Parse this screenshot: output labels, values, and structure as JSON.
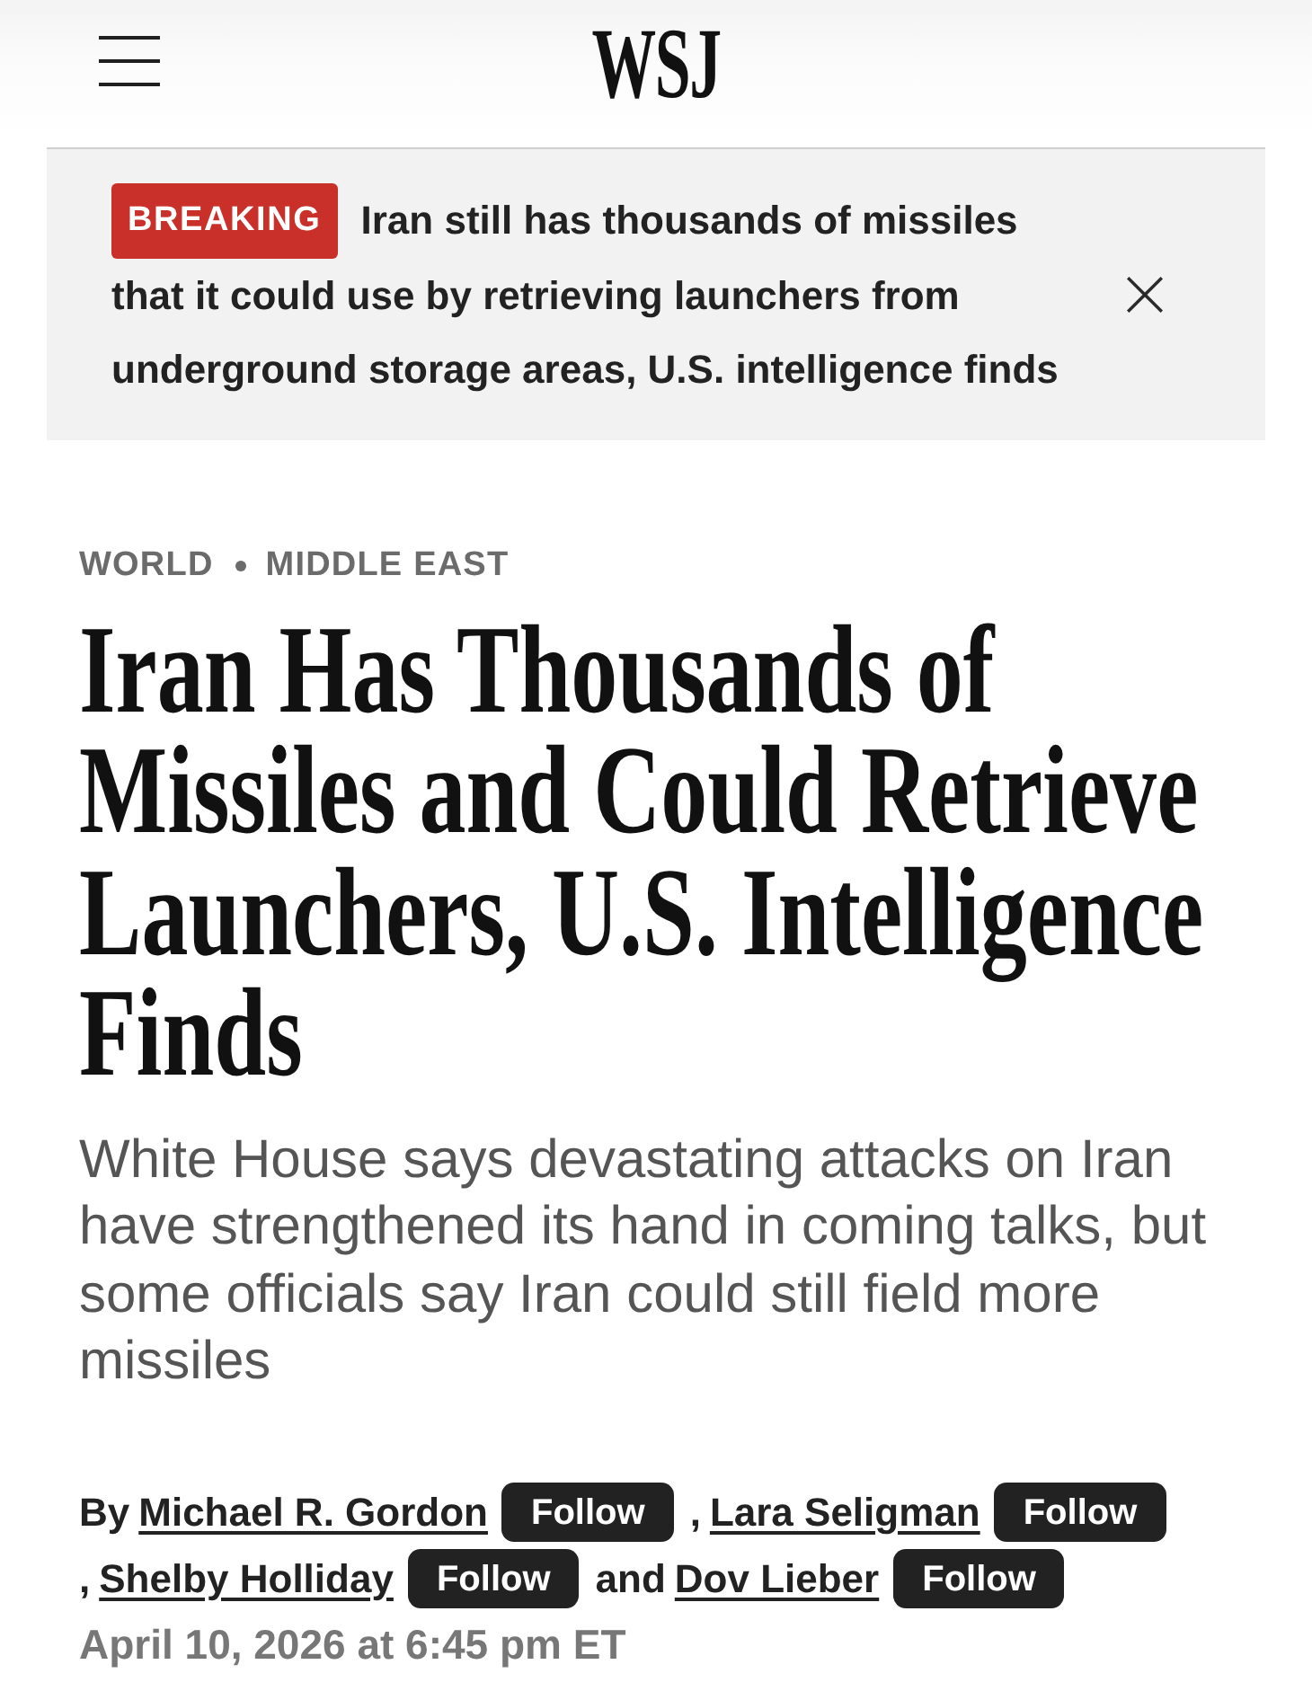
{
  "header": {
    "logo": "WSJ"
  },
  "breaking": {
    "badge": "BREAKING",
    "headline": "Iran still has thousands of missiles that it could use by retrieving launchers from underground storage areas, U.S. intelligence finds"
  },
  "article": {
    "sections": [
      "WORLD",
      "MIDDLE EAST"
    ],
    "headline": "Iran Has Thousands of Missiles and Could Retrieve Launchers, U.S. Intelligence Finds",
    "summary": "White House says devastating attacks on Iran have strengthened its hand in coming talks, but some officials say Iran could still field more missiles",
    "authors": [
      {
        "prefix": "By",
        "name": "Michael R. Gordon",
        "follow": "Follow"
      },
      {
        "prefix": ",",
        "name": "Lara Seligman",
        "follow": "Follow"
      },
      {
        "prefix": ",",
        "name": "Shelby Holliday",
        "follow": "Follow"
      },
      {
        "prefix": "and",
        "name": "Dov Lieber",
        "follow": "Follow"
      }
    ],
    "timestamp": "April 10, 2026 at 6:45 pm ET"
  }
}
